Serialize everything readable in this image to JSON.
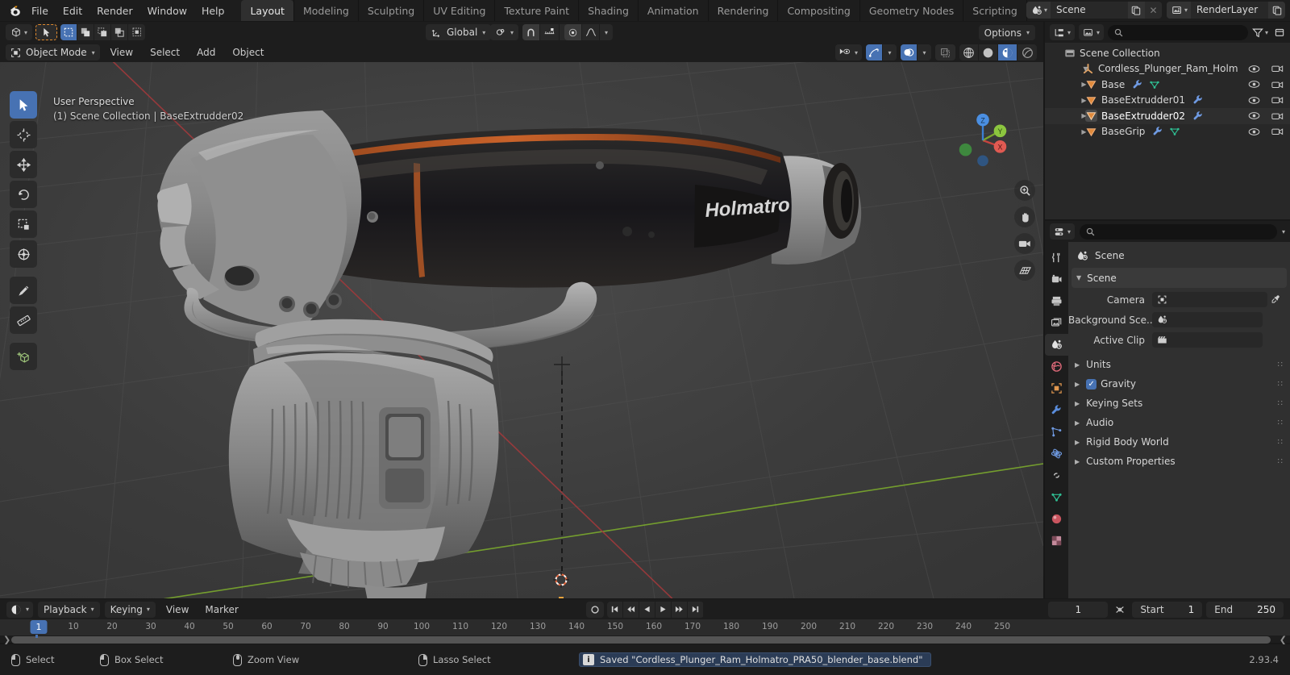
{
  "app": {
    "title": "Blender",
    "version": "2.93.4"
  },
  "topbar": {
    "logo_icon": "blender-logo-icon",
    "menus": [
      "File",
      "Edit",
      "Render",
      "Window",
      "Help"
    ],
    "workspace_tabs": [
      {
        "label": "Layout",
        "active": true
      },
      {
        "label": "Modeling",
        "active": false
      },
      {
        "label": "Sculpting",
        "active": false
      },
      {
        "label": "UV Editing",
        "active": false
      },
      {
        "label": "Texture Paint",
        "active": false
      },
      {
        "label": "Shading",
        "active": false
      },
      {
        "label": "Animation",
        "active": false
      },
      {
        "label": "Rendering",
        "active": false
      },
      {
        "label": "Compositing",
        "active": false
      },
      {
        "label": "Geometry Nodes",
        "active": false
      },
      {
        "label": "Scripting",
        "active": false
      }
    ],
    "add_workspace_label": "+",
    "scene": {
      "icon": "scene-icon",
      "name": "Scene",
      "new_icon": "copy-icon",
      "unlink_icon": "x-icon"
    },
    "viewlayer": {
      "icon": "viewlayer-icon",
      "name": "RenderLayer",
      "new_icon": "copy-icon"
    }
  },
  "viewport": {
    "header": {
      "editor_type_icon": "editor-type-3dview-icon",
      "select_modes": [
        "tweak-icon",
        "select-box-icon",
        "select-circle-icon",
        "select-lasso-icon",
        "select-extend-icon"
      ],
      "transform_orientation": "Global",
      "pivot_icon": "pivot-point-icon",
      "snap_icon": "magnet-icon",
      "snap_target_icon": "snap-increment-icon",
      "proportional_icon": "proportional-edit-icon",
      "falloff_icon": "smooth-falloff-icon",
      "options_label": "Options",
      "visibility_icon": "show-gizmo-icon",
      "gizmo_icon": "gizmo-icon",
      "overlays_icon": "overlays-icon",
      "xray_icon": "xray-icon",
      "shading_modes": [
        "wireframe-icon",
        "solid-icon",
        "material-preview-icon",
        "rendered-icon"
      ],
      "shading_active_index": 2
    },
    "header2": {
      "mode": "Object Mode",
      "mode_icon": "object-mode-icon",
      "menus": [
        "View",
        "Select",
        "Add",
        "Object"
      ]
    },
    "overlay_text_line1": "User Perspective",
    "overlay_text_line2": "(1) Scene Collection | BaseExtrudder02",
    "tools": [
      {
        "name": "tweak-tool",
        "icon": "cursor-arrow-icon",
        "active": true
      },
      {
        "name": "cursor-tool",
        "icon": "3d-cursor-icon",
        "active": false
      },
      {
        "name": "move-tool",
        "icon": "move-icon",
        "active": false
      },
      {
        "name": "rotate-tool",
        "icon": "rotate-icon",
        "active": false
      },
      {
        "name": "scale-tool",
        "icon": "scale-icon",
        "active": false
      },
      {
        "name": "transform-tool",
        "icon": "transform-icon",
        "active": false
      },
      {
        "name": "annotate-tool",
        "icon": "pencil-icon",
        "active": false
      },
      {
        "name": "measure-tool",
        "icon": "ruler-icon",
        "active": false
      },
      {
        "name": "add-cube-tool",
        "icon": "add-cube-icon",
        "active": false
      }
    ],
    "nav_buttons": [
      "zoom-icon",
      "pan-hand-icon",
      "camera-icon",
      "grid-ortho-icon"
    ],
    "gizmo_axes": [
      "X",
      "Y",
      "Z"
    ]
  },
  "outliner": {
    "display_mode_icon": "outliner-display-icon",
    "filter_id_icon": "filter-id-icon",
    "search_placeholder": "",
    "search_icon": "search-icon",
    "filter_icon": "filter-funnel-icon",
    "rows": [
      {
        "name": "Scene Collection",
        "icon": "scene-collection-icon",
        "indent": 0,
        "disclosure": "",
        "selected": false,
        "modifiers": [],
        "eye": false,
        "camera": false
      },
      {
        "name": "Cordless_Plunger_Ram_Holm",
        "icon": "empty-axis-icon",
        "indent": 1,
        "disclosure": "open",
        "selected": false,
        "modifiers": [],
        "eye": true,
        "camera": true
      },
      {
        "name": "Base",
        "icon": "mesh-object-icon",
        "indent": 2,
        "disclosure": "closed",
        "selected": false,
        "modifiers": [
          "wrench-icon",
          "mesh-data-icon"
        ],
        "eye": true,
        "camera": true
      },
      {
        "name": "BaseExtrudder01",
        "icon": "mesh-object-icon",
        "indent": 2,
        "disclosure": "closed",
        "selected": false,
        "modifiers": [
          "wrench-icon"
        ],
        "eye": true,
        "camera": true
      },
      {
        "name": "BaseExtrudder02",
        "icon": "mesh-object-icon",
        "indent": 2,
        "disclosure": "closed",
        "selected": true,
        "modifiers": [
          "wrench-icon"
        ],
        "eye": true,
        "camera": true
      },
      {
        "name": "BaseGrip",
        "icon": "mesh-object-icon",
        "indent": 2,
        "disclosure": "closed",
        "selected": false,
        "modifiers": [
          "wrench-icon",
          "mesh-data-icon"
        ],
        "eye": true,
        "camera": true
      }
    ]
  },
  "properties": {
    "editor_icon": "properties-editor-icon",
    "search_placeholder": "",
    "search_icon": "search-icon",
    "tabs": [
      {
        "name": "tool",
        "icon": "tool-icon",
        "active": false
      },
      {
        "name": "render",
        "icon": "render-camera-icon",
        "active": false
      },
      {
        "name": "output",
        "icon": "printer-icon",
        "active": false
      },
      {
        "name": "view-layer",
        "icon": "images-icon",
        "active": false
      },
      {
        "name": "scene",
        "icon": "scene-icon",
        "active": true
      },
      {
        "name": "world",
        "icon": "world-icon",
        "active": false
      },
      {
        "name": "object",
        "icon": "object-square-icon",
        "active": false
      },
      {
        "name": "modifiers",
        "icon": "wrench-icon",
        "active": false
      },
      {
        "name": "particles",
        "icon": "particles-icon",
        "active": false
      },
      {
        "name": "physics",
        "icon": "physics-orbit-icon",
        "active": false
      },
      {
        "name": "constraints",
        "icon": "constraint-icon",
        "active": false
      },
      {
        "name": "data",
        "icon": "green-triangle-data-icon",
        "active": false
      },
      {
        "name": "material",
        "icon": "material-sphere-icon",
        "active": false
      },
      {
        "name": "texture",
        "icon": "texture-checker-icon",
        "active": false
      }
    ],
    "breadcrumb": {
      "icon": "scene-icon",
      "label": "Scene"
    },
    "panel_title": "Scene",
    "fields": [
      {
        "label": "Camera",
        "value": "",
        "icon": "camera-data-icon",
        "eyedropper": true
      },
      {
        "label": "Background Sce...",
        "value": "",
        "icon": "scene-icon",
        "eyedropper": false
      },
      {
        "label": "Active Clip",
        "value": "",
        "icon": "clip-icon",
        "eyedropper": false
      }
    ],
    "closed_panels": [
      {
        "label": "Units",
        "checkbox": null
      },
      {
        "label": "Gravity",
        "checkbox": true
      },
      {
        "label": "Keying Sets",
        "checkbox": null
      },
      {
        "label": "Audio",
        "checkbox": null
      },
      {
        "label": "Rigid Body World",
        "checkbox": null
      },
      {
        "label": "Custom Properties",
        "checkbox": null
      }
    ]
  },
  "timeline": {
    "editor_icon": "timeline-editor-icon",
    "menus_dropdowns": [
      "Playback",
      "Keying"
    ],
    "menus": [
      "View",
      "Marker"
    ],
    "record_icon": "record-icon",
    "transport": [
      "jump-start-icon",
      "prev-keyframe-icon",
      "play-reverse-icon",
      "play-icon",
      "next-keyframe-icon",
      "jump-end-icon"
    ],
    "current_frame": "1",
    "sync_icon": "sync-icon",
    "start_label": "Start",
    "start_value": "1",
    "end_label": "End",
    "end_value": "250",
    "ruler_ticks": [
      "10",
      "20",
      "30",
      "40",
      "50",
      "60",
      "70",
      "80",
      "90",
      "100",
      "110",
      "120",
      "130",
      "140",
      "150",
      "160",
      "170",
      "180",
      "190",
      "200",
      "210",
      "220",
      "230",
      "240",
      "250"
    ],
    "playhead_frame": "1"
  },
  "statusbar": {
    "keymap": [
      {
        "icon": "mouse-left-icon",
        "label": "Select"
      },
      {
        "icon": "mouse-left-drag-icon",
        "label": "Box Select"
      },
      {
        "icon": "mouse-middle-icon",
        "label": "Zoom View"
      },
      {
        "icon": "mouse-right-icon",
        "label": "Lasso Select"
      }
    ],
    "report": {
      "badge": "i",
      "message": "Saved \"Cordless_Plunger_Ram_Holmatro_PRA50_blender_base.blend\""
    },
    "version": "2.93.4"
  },
  "colors": {
    "accent": "#4772b3",
    "bg_dark": "#1d1d1d",
    "panel": "#303030",
    "field": "#282828",
    "viewport": "#3c3c3c",
    "orange": "#ed9e5c",
    "axis_x": "#c04a4a",
    "axis_y": "#8bc34a"
  }
}
